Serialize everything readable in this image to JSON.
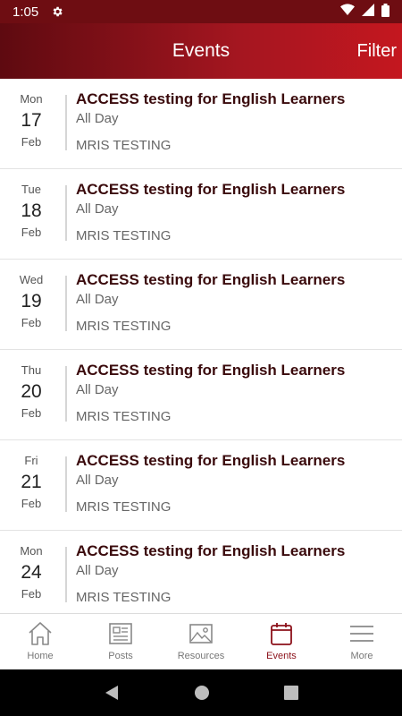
{
  "status_bar": {
    "time": "1:05"
  },
  "header": {
    "title": "Events",
    "filter_label": "Filter"
  },
  "events": [
    {
      "dow": "Mon",
      "day": "17",
      "month": "Feb",
      "title": "ACCESS testing for English Learners",
      "time": "All Day",
      "location": "MRIS TESTING"
    },
    {
      "dow": "Tue",
      "day": "18",
      "month": "Feb",
      "title": "ACCESS testing for English Learners",
      "time": "All Day",
      "location": "MRIS TESTING"
    },
    {
      "dow": "Wed",
      "day": "19",
      "month": "Feb",
      "title": "ACCESS testing for English Learners",
      "time": "All Day",
      "location": "MRIS TESTING"
    },
    {
      "dow": "Thu",
      "day": "20",
      "month": "Feb",
      "title": "ACCESS testing for English Learners",
      "time": "All Day",
      "location": "MRIS TESTING"
    },
    {
      "dow": "Fri",
      "day": "21",
      "month": "Feb",
      "title": "ACCESS testing for English Learners",
      "time": "All Day",
      "location": "MRIS TESTING"
    },
    {
      "dow": "Mon",
      "day": "24",
      "month": "Feb",
      "title": "ACCESS testing for English Learners",
      "time": "All Day",
      "location": "MRIS TESTING"
    }
  ],
  "tabbar": {
    "tabs": [
      {
        "label": "Home",
        "icon": "home-icon"
      },
      {
        "label": "Posts",
        "icon": "newspaper-icon"
      },
      {
        "label": "Resources",
        "icon": "image-icon"
      },
      {
        "label": "Events",
        "icon": "calendar-icon",
        "active": true
      },
      {
        "label": "More",
        "icon": "menu-icon"
      }
    ]
  },
  "colors": {
    "brand": "#8c111a",
    "header_dark": "#5e0a10",
    "header_light": "#c4171f"
  }
}
